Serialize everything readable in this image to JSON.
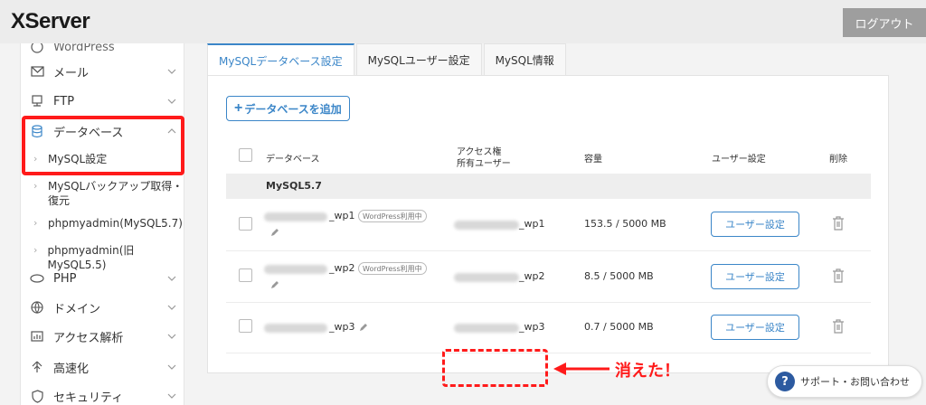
{
  "header": {
    "logo": "XServer",
    "logout_label": "ログアウト"
  },
  "sidebar": {
    "partial_top": "WordPress",
    "items": [
      {
        "label": "メール",
        "icon": "mail-icon"
      },
      {
        "label": "FTP",
        "icon": "ftp-icon"
      },
      {
        "label": "データベース",
        "icon": "database-icon"
      },
      {
        "label": "PHP",
        "icon": "php-icon"
      },
      {
        "label": "ドメイン",
        "icon": "globe-icon"
      },
      {
        "label": "アクセス解析",
        "icon": "chart-icon"
      },
      {
        "label": "高速化",
        "icon": "speed-icon"
      },
      {
        "label": "セキュリティ",
        "icon": "shield-icon"
      }
    ],
    "sub_items": [
      {
        "label": "MySQL設定"
      },
      {
        "label": "MySQLバックアップ取得・復元"
      },
      {
        "label": "phpmyadmin(MySQL5.7)"
      },
      {
        "label": "phpmyadmin(旧MySQL5.5)"
      }
    ]
  },
  "tabs": [
    {
      "label": "MySQLデータベース設定",
      "active": true
    },
    {
      "label": "MySQLユーザー設定",
      "active": false
    },
    {
      "label": "MySQL情報",
      "active": false
    }
  ],
  "main": {
    "add_button": "データベースを追加",
    "columns": {
      "database": "データベース",
      "access_line1": "アクセス権",
      "access_line2": "所有ユーザー",
      "capacity": "容量",
      "user_settings": "ユーザー設定",
      "delete": "削除"
    },
    "group_label": "MySQL5.7",
    "rows": [
      {
        "db_suffix": "_wp1",
        "badge": "WordPress利用中",
        "user_suffix": "_wp1",
        "capacity": "153.5 / 5000 MB",
        "button": "ユーザー設定"
      },
      {
        "db_suffix": "_wp2",
        "badge": "WordPress利用中",
        "user_suffix": "_wp2",
        "capacity": "8.5 / 5000 MB",
        "button": "ユーザー設定"
      },
      {
        "db_suffix": "_wp3",
        "badge": "",
        "user_suffix": "_wp3",
        "capacity": "0.7 / 5000 MB",
        "button": "ユーザー設定"
      }
    ]
  },
  "annotation": {
    "text": "消えた！",
    "color": "#ff1a1a"
  },
  "support": {
    "label": "サポート・お問い合わせ",
    "icon": "question-icon"
  },
  "colors": {
    "accent": "#3b86c8",
    "highlight": "#ff1a1a"
  }
}
